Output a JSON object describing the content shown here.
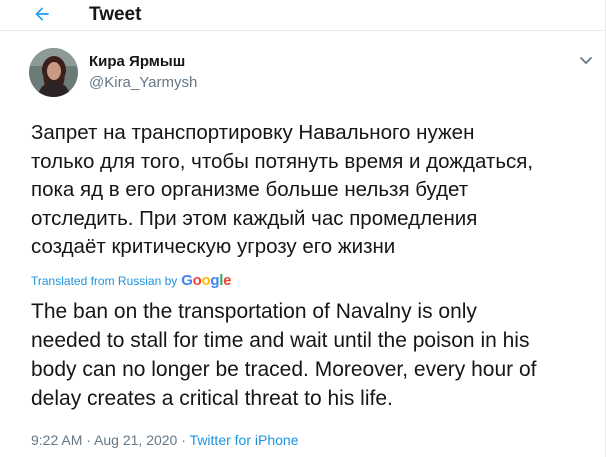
{
  "header": {
    "title": "Tweet",
    "back_icon": "arrow-left-icon"
  },
  "author": {
    "name": "Кира Ярмыш",
    "handle": "@Kira_Yarmysh"
  },
  "tweet": {
    "text_lines": [
      "Запрет на транспортировку Навального нужен",
      "только для того, чтобы потянуть время и дождаться,",
      "пока яд в его организме больше нельзя будет",
      "отследить. При этом каждый час промедления",
      "создаёт критическую угрозу его жизни"
    ]
  },
  "translation": {
    "label": "Translated from Russian by",
    "provider_letters": [
      "G",
      "o",
      "o",
      "g",
      "l",
      "e"
    ],
    "provider_colors": [
      "#4285F4",
      "#EA4335",
      "#FBBC05",
      "#4285F4",
      "#34A853",
      "#EA4335"
    ],
    "text_lines": [
      "The ban on the transportation of Navalny is only",
      "needed to stall for time and wait until the poison in his",
      "body can no longer be traced. Moreover, every hour of",
      "delay creates a critical threat to his life."
    ]
  },
  "meta": {
    "time": "9:22 AM",
    "separator1": " · ",
    "date": "Aug 21, 2020",
    "separator2": " · ",
    "source": "Twitter for iPhone"
  },
  "colors": {
    "link": "#1b95e0",
    "secondary": "#657786",
    "text": "#14171a",
    "border": "#e6ecf0"
  }
}
